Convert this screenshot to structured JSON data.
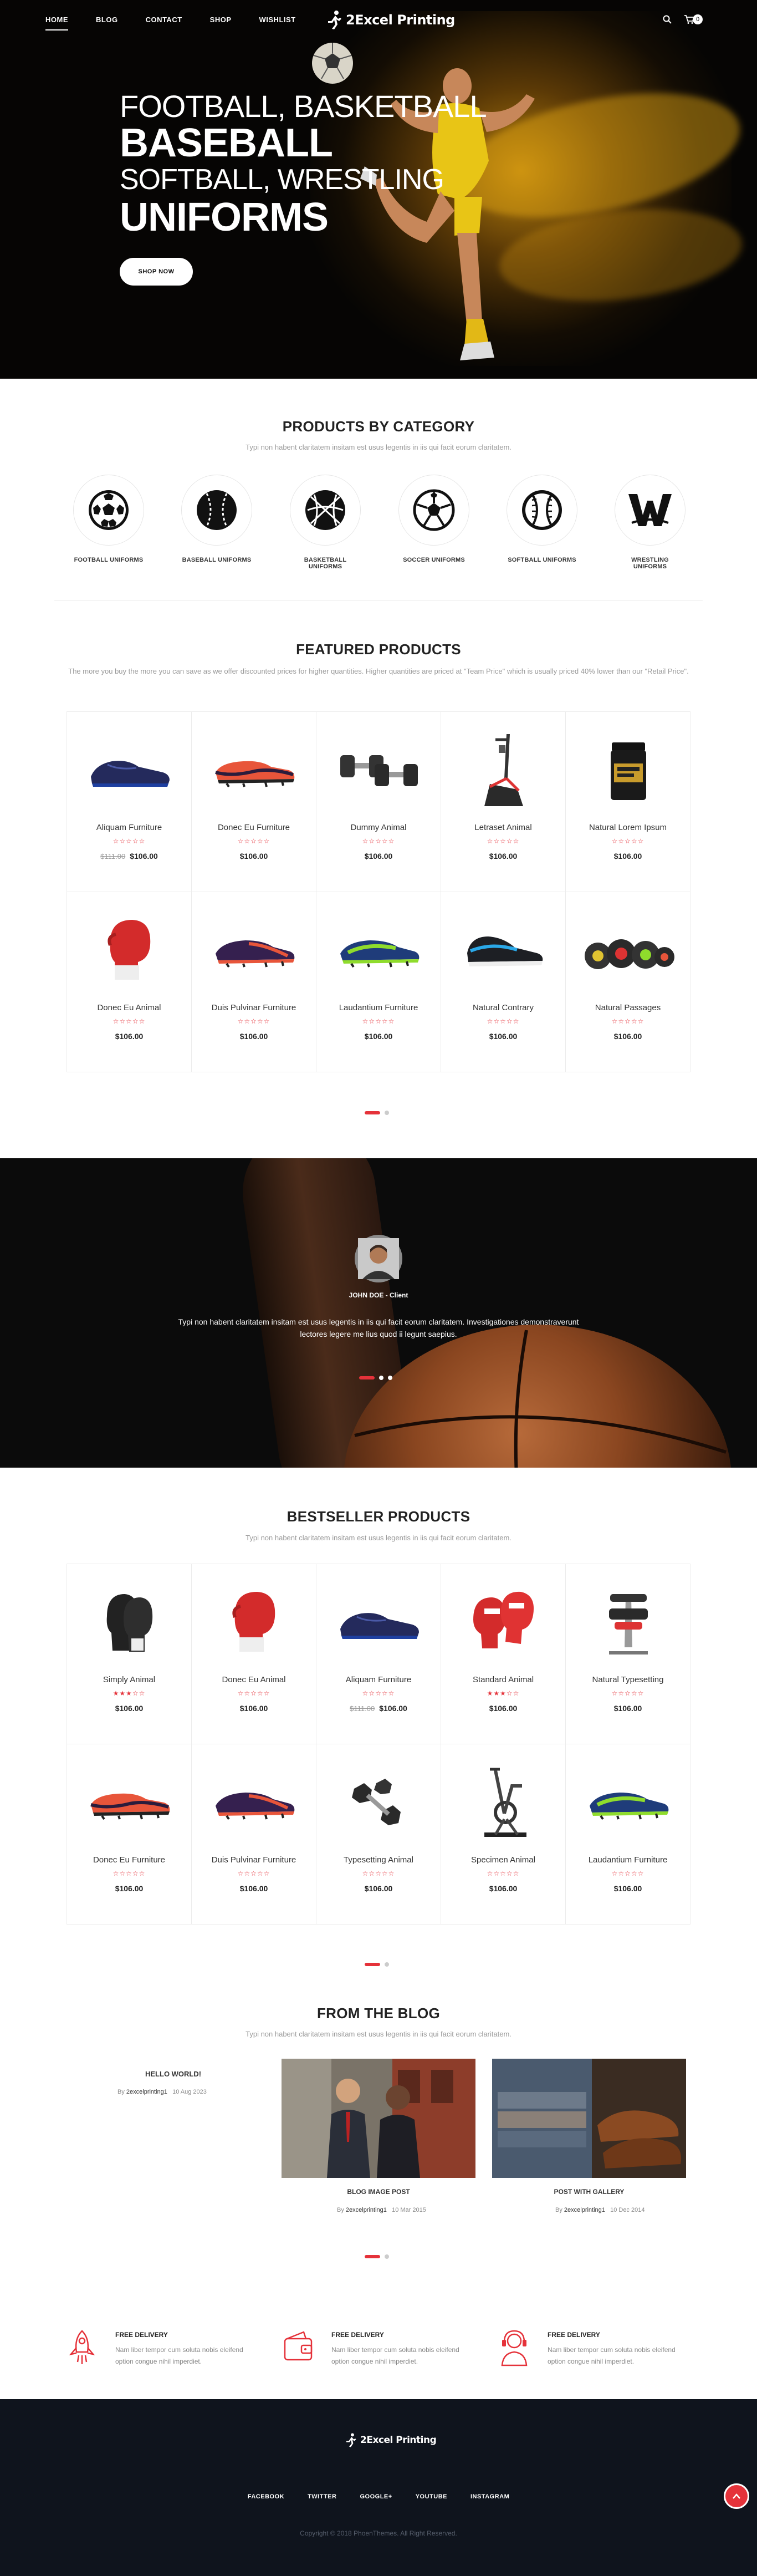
{
  "nav": {
    "items": [
      "HOME",
      "BLOG",
      "CONTACT",
      "SHOP",
      "WISHLIST"
    ],
    "logo": "2Excel Printing",
    "cart_count": "0"
  },
  "hero": {
    "line1": "FOOTBALL, BASKETBALL",
    "line2": "BASEBALL",
    "line3": "SOFTBALL, WRESTLING",
    "line4": "UNIFORMS",
    "button": "SHOP NOW"
  },
  "categories": {
    "title": "PRODUCTS BY CATEGORY",
    "subtitle": "Typi non habent claritatem insitam est usus legentis in iis qui facit eorum claritatem.",
    "items": [
      "FOOTBALL UNIFORMS",
      "BASEBALL UNIFORMS",
      "BASKETBALL UNIFORMS",
      "SOCCER UNIFORMS",
      "SOFTBALL UNIFORMS",
      "WRESTLING UNIFORMS"
    ]
  },
  "featured": {
    "title": "FEATURED PRODUCTS",
    "subtitle": "The more you buy the more you can save as we offer discounted prices for higher quantities. Higher quantities are priced at \"Team Price\" which is usually priced 40% lower than our \"Retail Price\".",
    "products": [
      {
        "name": "Aliquam Furniture",
        "price": "$106.00",
        "old": "$111.00",
        "rating": 0
      },
      {
        "name": "Donec Eu Furniture",
        "price": "$106.00",
        "old": "",
        "rating": 0
      },
      {
        "name": "Dummy Animal",
        "price": "$106.00",
        "old": "",
        "rating": 0
      },
      {
        "name": "Letraset Animal",
        "price": "$106.00",
        "old": "",
        "rating": 0
      },
      {
        "name": "Natural Lorem Ipsum",
        "price": "$106.00",
        "old": "",
        "rating": 0
      },
      {
        "name": "Donec Eu Animal",
        "price": "$106.00",
        "old": "",
        "rating": 0
      },
      {
        "name": "Duis Pulvinar Furniture",
        "price": "$106.00",
        "old": "",
        "rating": 0
      },
      {
        "name": "Laudantium Furniture",
        "price": "$106.00",
        "old": "",
        "rating": 0
      },
      {
        "name": "Natural Contrary",
        "price": "$106.00",
        "old": "",
        "rating": 0
      },
      {
        "name": "Natural Passages",
        "price": "$106.00",
        "old": "",
        "rating": 0
      }
    ]
  },
  "testimonial": {
    "name": "JOHN DOE - Client",
    "quote": "Typi non habent claritatem insitam est usus legentis in iis qui facit eorum claritatem. Investigationes demonstraverunt lectores legere me lius quod ii legunt saepius."
  },
  "bestseller": {
    "title": "BESTSELLER PRODUCTS",
    "subtitle": "Typi non habent claritatem insitam est usus legentis in iis qui facit eorum claritatem.",
    "products": [
      {
        "name": "Simply Animal",
        "price": "$106.00",
        "old": "",
        "rating": 3
      },
      {
        "name": "Donec Eu Animal",
        "price": "$106.00",
        "old": "",
        "rating": 0
      },
      {
        "name": "Aliquam Furniture",
        "price": "$106.00",
        "old": "$111.00",
        "rating": 0
      },
      {
        "name": "Standard Animal",
        "price": "$106.00",
        "old": "",
        "rating": 3
      },
      {
        "name": "Natural Typesetting",
        "price": "$106.00",
        "old": "",
        "rating": 0
      },
      {
        "name": "Donec Eu Furniture",
        "price": "$106.00",
        "old": "",
        "rating": 0
      },
      {
        "name": "Duis Pulvinar Furniture",
        "price": "$106.00",
        "old": "",
        "rating": 0
      },
      {
        "name": "Typesetting Animal",
        "price": "$106.00",
        "old": "",
        "rating": 0
      },
      {
        "name": "Specimen Animal",
        "price": "$106.00",
        "old": "",
        "rating": 0
      },
      {
        "name": "Laudantium Furniture",
        "price": "$106.00",
        "old": "",
        "rating": 0
      }
    ]
  },
  "blog": {
    "title": "FROM THE BLOG",
    "subtitle": "Typi non habent claritatem insitam est usus legentis in iis qui facit eorum claritatem.",
    "posts": [
      {
        "title": "HELLO WORLD!",
        "by": "By",
        "author": "2excelprinting1",
        "date": "10 Aug 2023"
      },
      {
        "title": "BLOG IMAGE POST",
        "by": "By",
        "author": "2excelprinting1",
        "date": "10 Mar 2015"
      },
      {
        "title": "POST WITH GALLERY",
        "by": "By",
        "author": "2excelprinting1",
        "date": "10 Dec 2014"
      }
    ]
  },
  "features": [
    {
      "title": "FREE DELIVERY",
      "text": "Nam liber tempor cum soluta nobis eleifend option congue nihil imperdiet."
    },
    {
      "title": "FREE DELIVERY",
      "text": "Nam liber tempor cum soluta nobis eleifend option congue nihil imperdiet."
    },
    {
      "title": "FREE DELIVERY",
      "text": "Nam liber tempor cum soluta nobis eleifend option congue nihil imperdiet."
    }
  ],
  "footer": {
    "logo": "2Excel Printing",
    "links": [
      "FACEBOOK",
      "TWITTER",
      "GOOGLE+",
      "YOUTUBE",
      "INSTAGRAM"
    ],
    "copyright": "Copyright © 2018 PhoenThemes. All Right Reserved."
  },
  "colors": {
    "accent": "#e5323a",
    "footer_bg": "#0f141d",
    "hero_bg": "#060504"
  }
}
